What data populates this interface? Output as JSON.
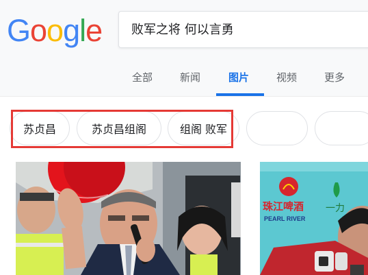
{
  "logo": {
    "letters": [
      "G",
      "o",
      "o",
      "g",
      "l",
      "e"
    ]
  },
  "search": {
    "value": "败军之将 何以言勇"
  },
  "tabs": [
    {
      "label": "全部"
    },
    {
      "label": "新闻"
    },
    {
      "label": "图片"
    },
    {
      "label": "视频"
    },
    {
      "label": "更多"
    }
  ],
  "active_tab": "图片",
  "chips": [
    {
      "label": "苏贞昌"
    },
    {
      "label": "苏贞昌组阁"
    },
    {
      "label": "组阁 败军"
    },
    {
      "label": ""
    },
    {
      "label": ""
    }
  ],
  "results": {
    "photo2_sign_cn": "珠江啤酒",
    "photo2_sign_en": "PEARL RIVER",
    "photo2_sign_side": "一力"
  },
  "colors": {
    "accent": "#1a73e8",
    "highlight": "#e53935",
    "logo": [
      "#4285f4",
      "#ea4335",
      "#fbbc05",
      "#4285f4",
      "#34a853",
      "#ea4335"
    ]
  }
}
